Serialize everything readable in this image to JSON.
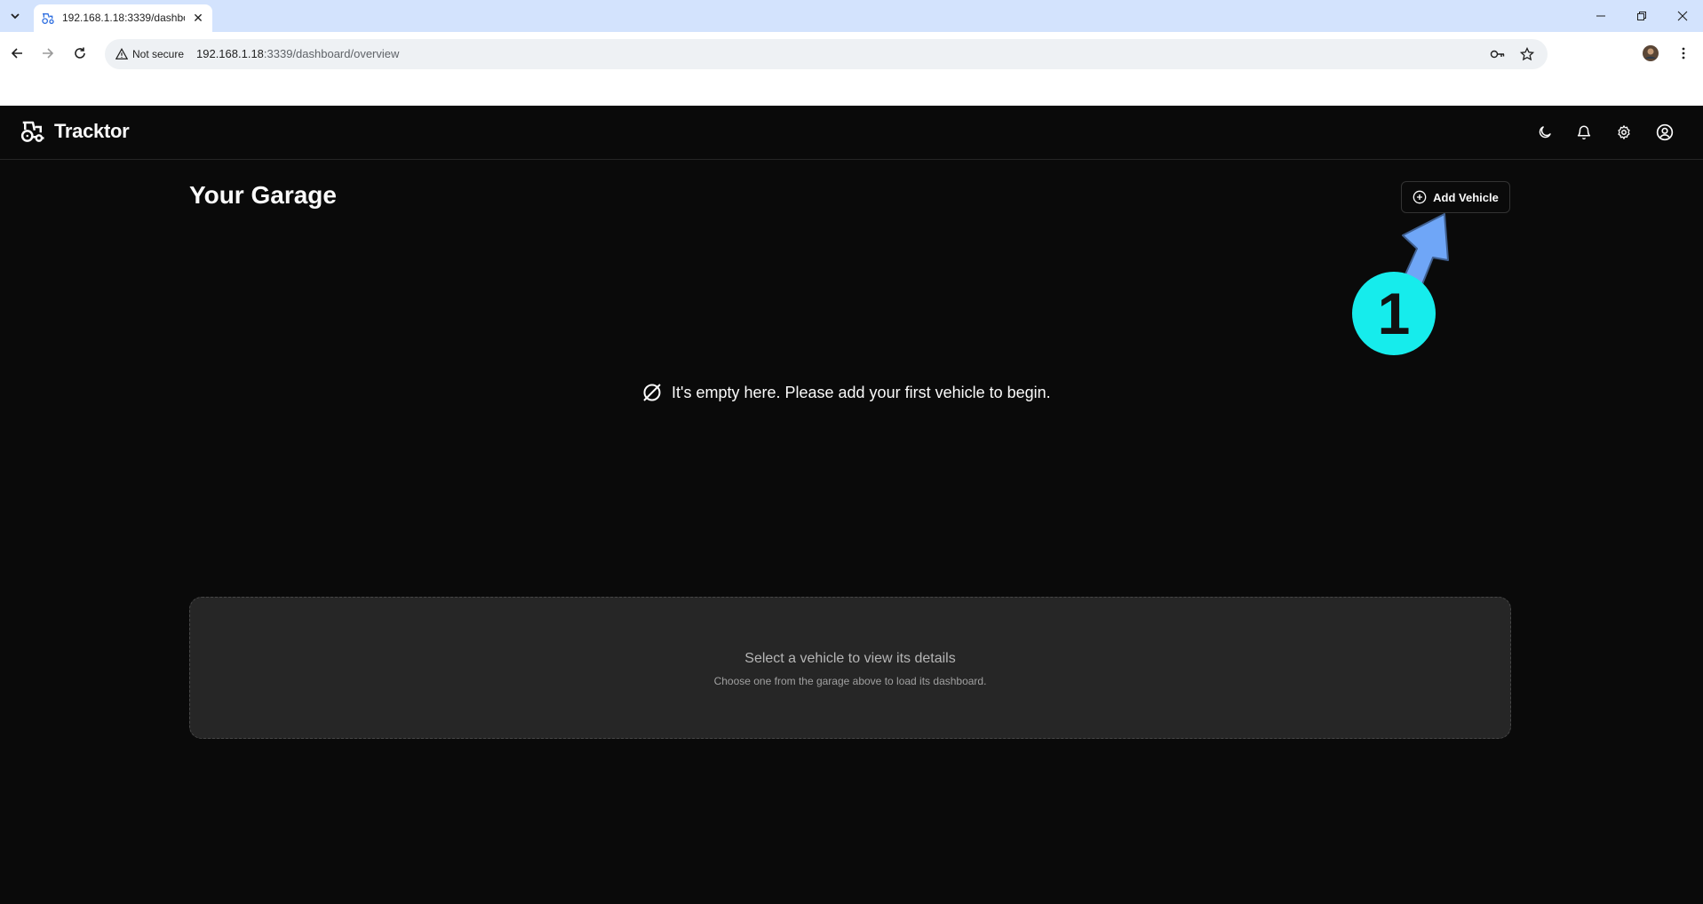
{
  "browser": {
    "tab_title": "192.168.1.18:3339/dashbo",
    "security_label": "Not secure",
    "url_host": "192.168.1.18",
    "url_rest": ":3339/dashboard/overview"
  },
  "app": {
    "brand_name": "Tracktor",
    "page_title": "Your Garage",
    "add_vehicle_label": "Add Vehicle",
    "empty_message": "It's empty here. Please add your first vehicle to begin.",
    "details_title": "Select a vehicle to view its details",
    "details_subtitle": "Choose one from the garage above to load its dashboard.",
    "header_icons": [
      "moon-icon",
      "bell-icon",
      "gear-icon",
      "user-circle-icon"
    ]
  },
  "annotation": {
    "step_number": "1",
    "badge_color": "#16ecec",
    "arrow_color": "#6fa6f7"
  },
  "colors": {
    "background": "#0a0a0a",
    "card": "#262626",
    "tabbar": "#d3e3fd"
  }
}
